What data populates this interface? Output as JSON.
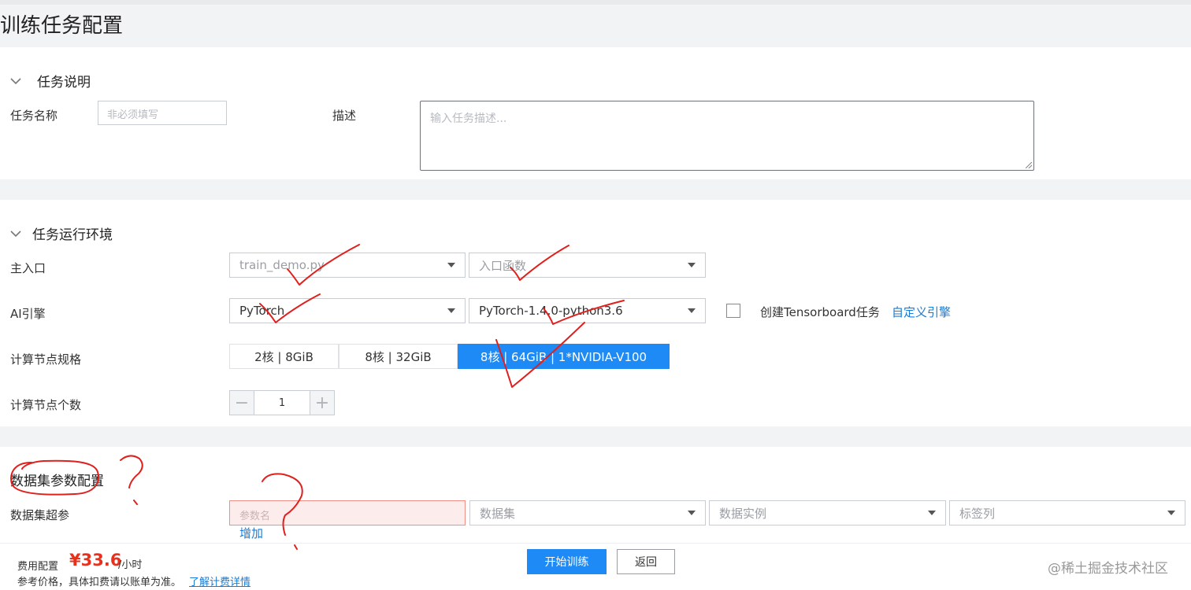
{
  "page": {
    "title": "训练任务配置"
  },
  "task_desc": {
    "section_title": "任务说明",
    "name_label": "任务名称",
    "name_placeholder": "非必须填写",
    "desc_label": "描述",
    "desc_placeholder": "输入任务描述..."
  },
  "runtime": {
    "section_title": "任务运行环境",
    "entry_label": "主入口",
    "entry_file": "train_demo.py",
    "entry_func": "入口函数",
    "engine_label": "AI引擎",
    "engine": "PyTorch",
    "engine_version": "PyTorch-1.4.0-python3.6",
    "tensorboard_label": "创建Tensorboard任务",
    "tensorboard_checked": false,
    "custom_engine_link": "自定义引擎",
    "spec_label": "计算节点规格",
    "specs": [
      "2核 | 8GiB",
      "8核 | 32GiB",
      "8核 | 64GiB | 1*NVIDIA-V100"
    ],
    "selected_spec_index": 2,
    "count_label": "计算节点个数",
    "count_value": "1",
    "minus_symbol": "−",
    "plus_symbol": "+"
  },
  "dataset": {
    "section_title": "数据集参数配置",
    "hyper_label": "数据集超参",
    "param_name_placeholder": "参数名",
    "dataset_placeholder": "数据集",
    "instance_placeholder": "数据实例",
    "label_col_placeholder": "标签列",
    "add_link": "增加"
  },
  "footer": {
    "cost_label": "费用配置",
    "cost_value": "¥33.6",
    "cost_unit": "/小时",
    "note": "参考价格，具体扣费请以账单为准。",
    "pricing_link": "了解计费详情",
    "start_button": "开始训练",
    "back_button": "返回"
  },
  "watermark": "@稀土掘金技术社区",
  "colors": {
    "primary": "#1e8af5",
    "price": "#e8311d",
    "link": "#1a7bd4",
    "error_bg": "#fdecec",
    "annotation": "#e0201c"
  },
  "icons": [
    "chevron-down-icon",
    "caret-down-icon",
    "minus-icon",
    "plus-icon",
    "resize-grip-icon"
  ]
}
